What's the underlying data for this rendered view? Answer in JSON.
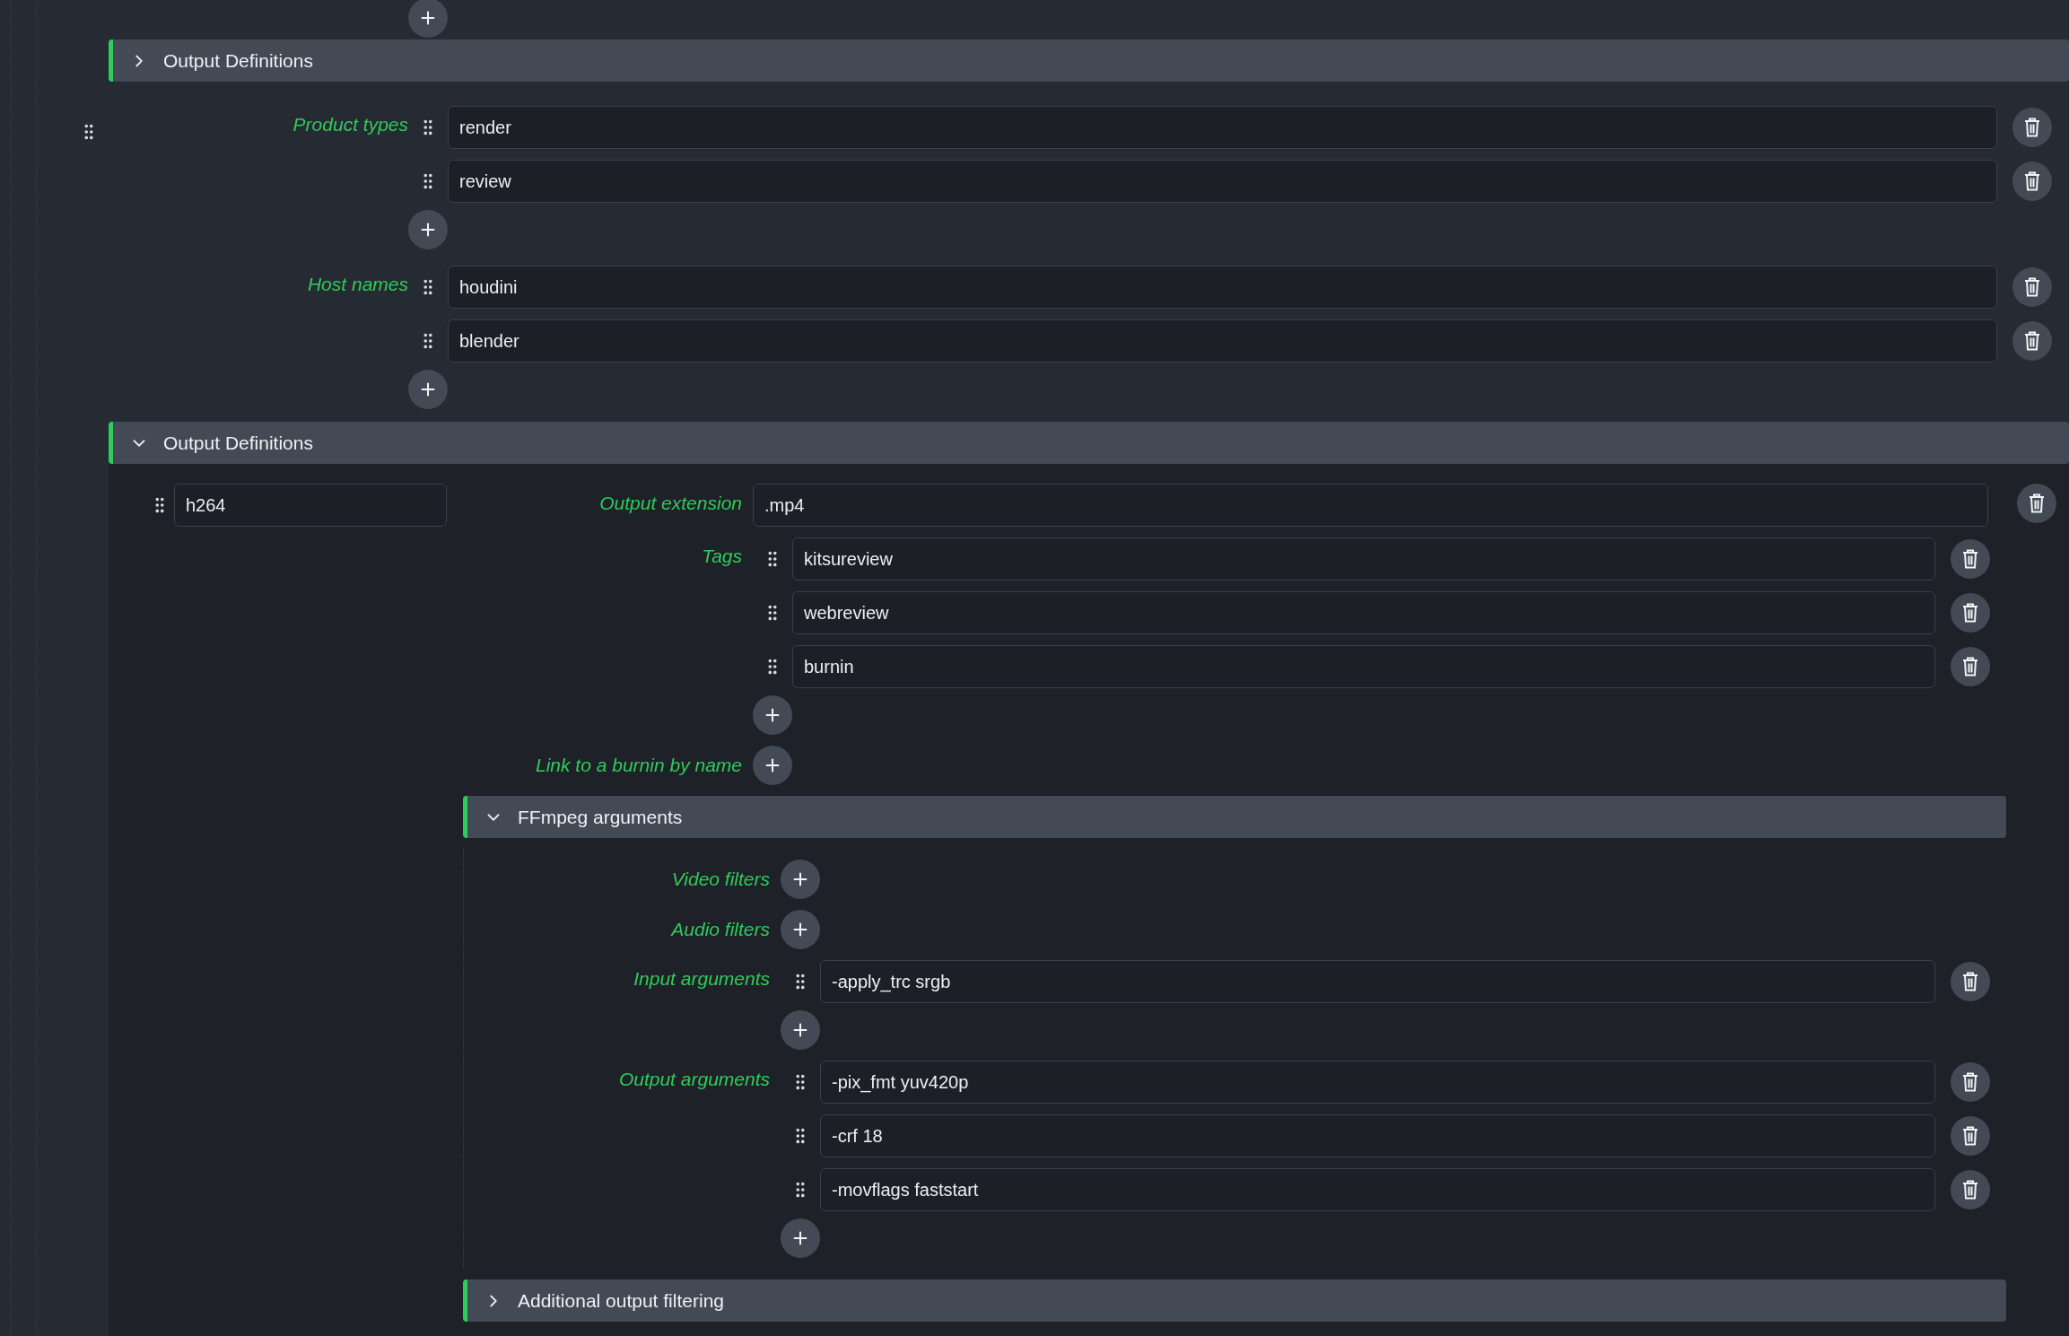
{
  "first_section": {
    "title": "Output Definitions",
    "expanded": false
  },
  "filter_lists": [
    {
      "label": "Product types",
      "items": [
        "render",
        "review"
      ]
    },
    {
      "label": "Host names",
      "items": [
        "houdini",
        "blender"
      ]
    }
  ],
  "output_section": {
    "title": "Output Definitions",
    "expanded": true,
    "definition": {
      "name": "h264",
      "output_extension": {
        "label": "Output extension",
        "value": ".mp4"
      },
      "lists": [
        {
          "label": "Tags",
          "items": [
            "kitsureview",
            "webreview",
            "burnin"
          ]
        },
        {
          "label": "Link to a burnin by name"
        }
      ],
      "ffmpeg": {
        "title": "FFmpeg arguments",
        "expanded": true,
        "lists": [
          {
            "label": "Video filters"
          },
          {
            "label": "Audio filters"
          },
          {
            "label": "Input arguments",
            "items": [
              "-apply_trc srgb"
            ]
          },
          {
            "label": "Output arguments",
            "items": [
              "-pix_fmt yuv420p",
              "-crf 18",
              "-movflags faststart"
            ]
          }
        ]
      },
      "additional": {
        "title": "Additional output filtering",
        "expanded": false
      }
    }
  }
}
